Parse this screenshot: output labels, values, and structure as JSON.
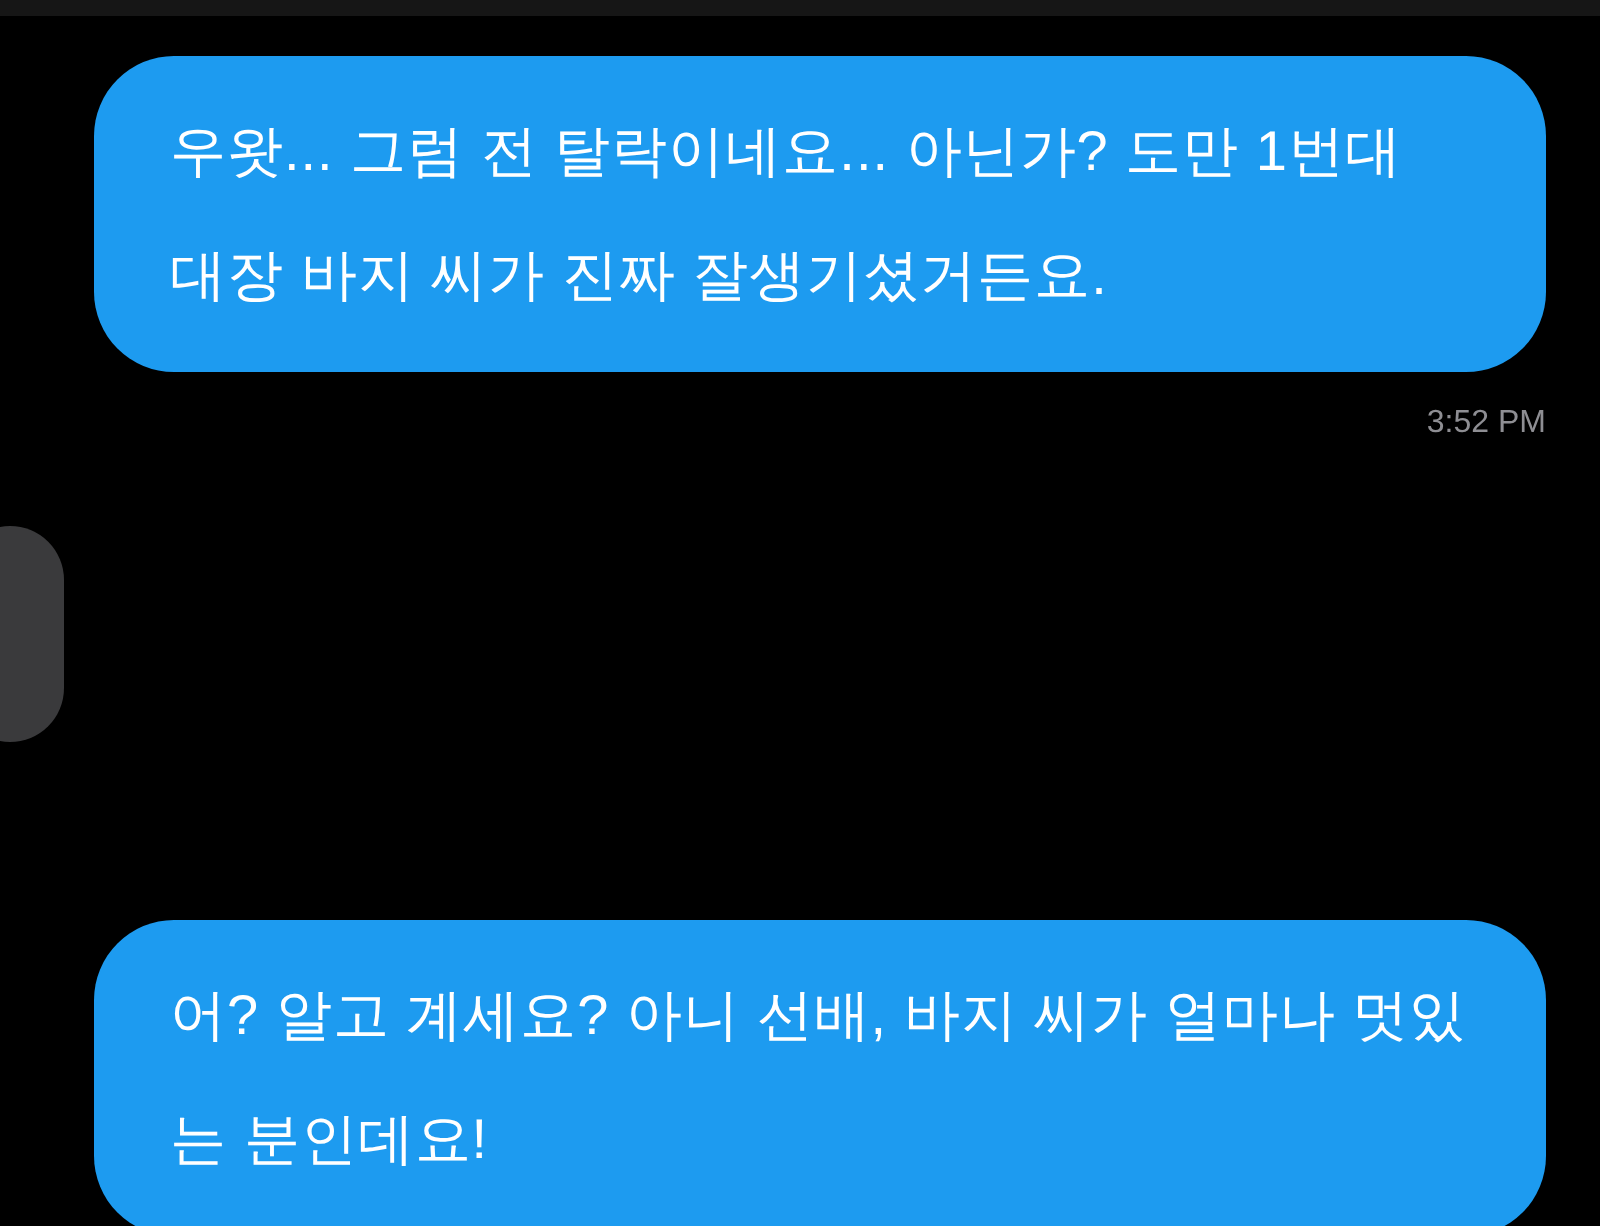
{
  "messages": [
    {
      "kind": "sent",
      "text": "우왓... 그럼 전 탈락이네요... 아닌가? 도만 1번대 대장 바지 씨가 진짜 잘생기셨거든요.",
      "time": "3:52 PM"
    },
    {
      "kind": "sent",
      "text": "어? 알고 계세요? 아니 선배, 바지 씨가 얼마나 멋있는 분인데요!"
    }
  ]
}
